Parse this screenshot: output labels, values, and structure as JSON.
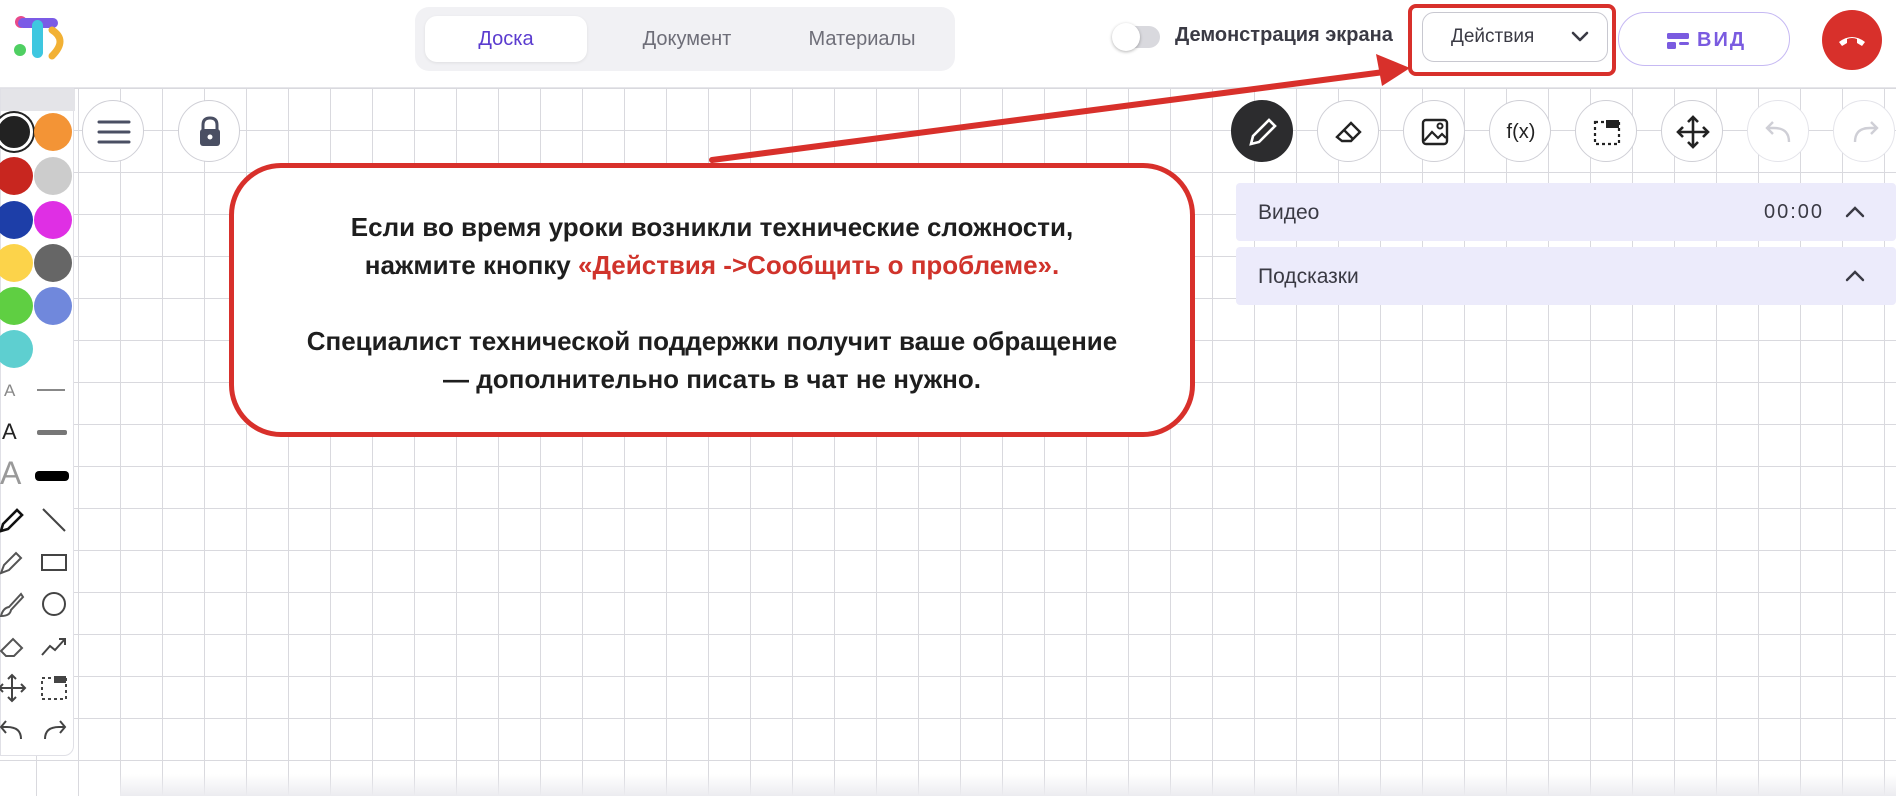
{
  "header": {
    "tabs": [
      {
        "label": "Доска",
        "active": true
      },
      {
        "label": "Документ",
        "active": false
      },
      {
        "label": "Материалы",
        "active": false
      }
    ],
    "screen_share_label": "Демонстрация экрана",
    "actions_label": "Действия",
    "view_label": "ВИД"
  },
  "panels": {
    "video_title": "Видео",
    "video_time": "00:00",
    "hints_title": "Подсказки"
  },
  "callout": {
    "line1": "Если во время уроки возникли технические сложности,",
    "line2_prefix": "нажмите кнопку ",
    "line2_highlight": "«Действия ->Сообщить о проблеме».",
    "line3": "Специалист технической поддержки получит ваше обращение",
    "line4": "— дополнительно писать в чат не нужно."
  },
  "left_tools": {
    "text_small": "A",
    "text_medium": "A",
    "text_large": "A"
  },
  "top_tools": {
    "formula_label": "f(x)"
  },
  "colors": {
    "accent": "#5b3ccf",
    "alert_red": "#d8302b",
    "panel_bg": "#ecebfb",
    "swatches": [
      "#222222",
      "#f39436",
      "#c8261f",
      "#cccccc",
      "#1d3ea8",
      "#df2fe4",
      "#fcd34a",
      "#666666",
      "#5fcf42",
      "#7088dc",
      "#5ecfd0"
    ]
  }
}
